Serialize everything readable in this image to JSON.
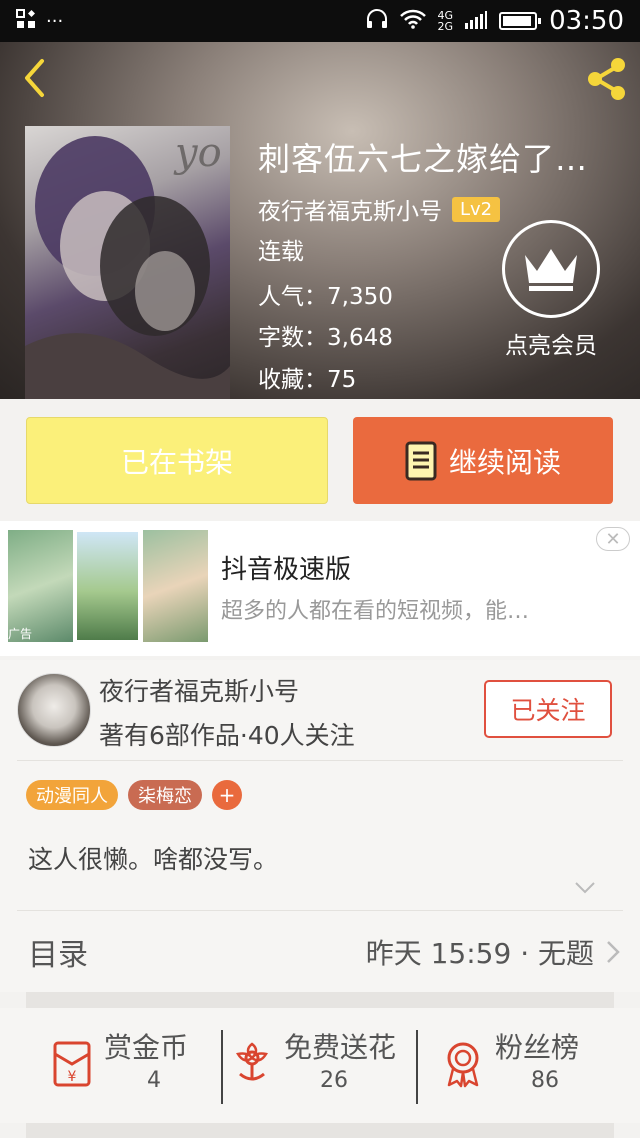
{
  "status_bar": {
    "time": "03:50",
    "network": "4G",
    "network2": "2G"
  },
  "book": {
    "title": "刺客伍六七之嫁给了…",
    "author": "夜行者福克斯小号",
    "level": "Lv2",
    "status": "连载",
    "popularity_label": "人气：",
    "popularity": "7,350",
    "words_label": "字数：",
    "words": "3,648",
    "favorites_label": "收藏：",
    "favorites": "75"
  },
  "vip": {
    "label": "点亮会员"
  },
  "actions": {
    "shelf_label": "已在书架",
    "read_label": "继续阅读"
  },
  "ad": {
    "title": "抖音极速版",
    "description": "超多的人都在看的短视频，能…",
    "tag": "广告",
    "close": "✕"
  },
  "author_card": {
    "name": "夜行者福克斯小号",
    "stats": "著有6部作品·40人关注",
    "follow_label": "已关注",
    "tags": [
      {
        "label": "动漫同人",
        "color": "#f2a43a"
      },
      {
        "label": "柒梅恋",
        "color": "#c96b52"
      }
    ],
    "add_tag": "+",
    "bio": "这人很懒。啥都没写。"
  },
  "catalog": {
    "label": "目录",
    "latest": "昨天 15:59 · 无题"
  },
  "stats": [
    {
      "label": "赏金币",
      "value": "4",
      "icon": "red-envelope-icon"
    },
    {
      "label": "免费送花",
      "value": "26",
      "icon": "flower-icon"
    },
    {
      "label": "粉丝榜",
      "value": "86",
      "icon": "medal-icon"
    }
  ],
  "colors": {
    "accent": "#ea6a3e",
    "shelf": "#fbf07a",
    "lv": "#f5c242",
    "follow": "#e0503f"
  }
}
